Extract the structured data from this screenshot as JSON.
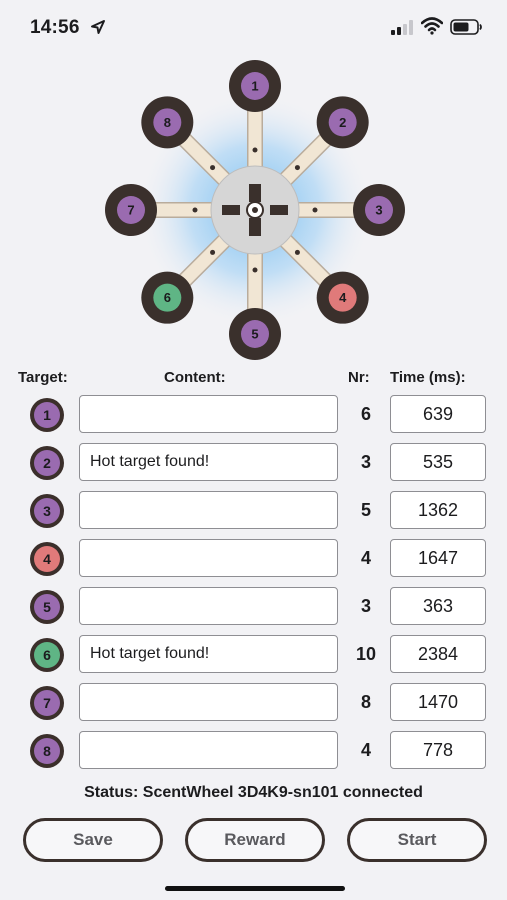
{
  "status_bar": {
    "time": "14:56",
    "location_icon": "location-arrow-icon",
    "signal_icon": "cellular-signal-icon",
    "wifi_icon": "wifi-icon",
    "battery_icon": "battery-icon"
  },
  "wheel": {
    "targets": [
      {
        "label": "1",
        "color": "#9a6bb0"
      },
      {
        "label": "2",
        "color": "#9a6bb0"
      },
      {
        "label": "3",
        "color": "#9a6bb0"
      },
      {
        "label": "4",
        "color": "#e07a7a"
      },
      {
        "label": "5",
        "color": "#9a6bb0"
      },
      {
        "label": "6",
        "color": "#5fb585"
      },
      {
        "label": "7",
        "color": "#9a6bb0"
      },
      {
        "label": "8",
        "color": "#9a6bb0"
      }
    ]
  },
  "table": {
    "headers": {
      "target": "Target:",
      "content": "Content:",
      "nr": "Nr:",
      "time": "Time (ms):"
    },
    "rows": [
      {
        "target": "1",
        "color": "#9a6bb0",
        "content": "",
        "nr": "6",
        "time": "639"
      },
      {
        "target": "2",
        "color": "#9a6bb0",
        "content": "Hot target found!",
        "nr": "3",
        "time": "535"
      },
      {
        "target": "3",
        "color": "#9a6bb0",
        "content": "",
        "nr": "5",
        "time": "1362"
      },
      {
        "target": "4",
        "color": "#e07a7a",
        "content": "",
        "nr": "4",
        "time": "1647"
      },
      {
        "target": "5",
        "color": "#9a6bb0",
        "content": "",
        "nr": "3",
        "time": "363"
      },
      {
        "target": "6",
        "color": "#5fb585",
        "content": "Hot target found!",
        "nr": "10",
        "time": "2384"
      },
      {
        "target": "7",
        "color": "#9a6bb0",
        "content": "",
        "nr": "8",
        "time": "1470"
      },
      {
        "target": "8",
        "color": "#9a6bb0",
        "content": "",
        "nr": "4",
        "time": "778"
      }
    ]
  },
  "status": "Status: ScentWheel 3D4K9-sn101 connected",
  "buttons": {
    "save": "Save",
    "reward": "Reward",
    "start": "Start"
  }
}
